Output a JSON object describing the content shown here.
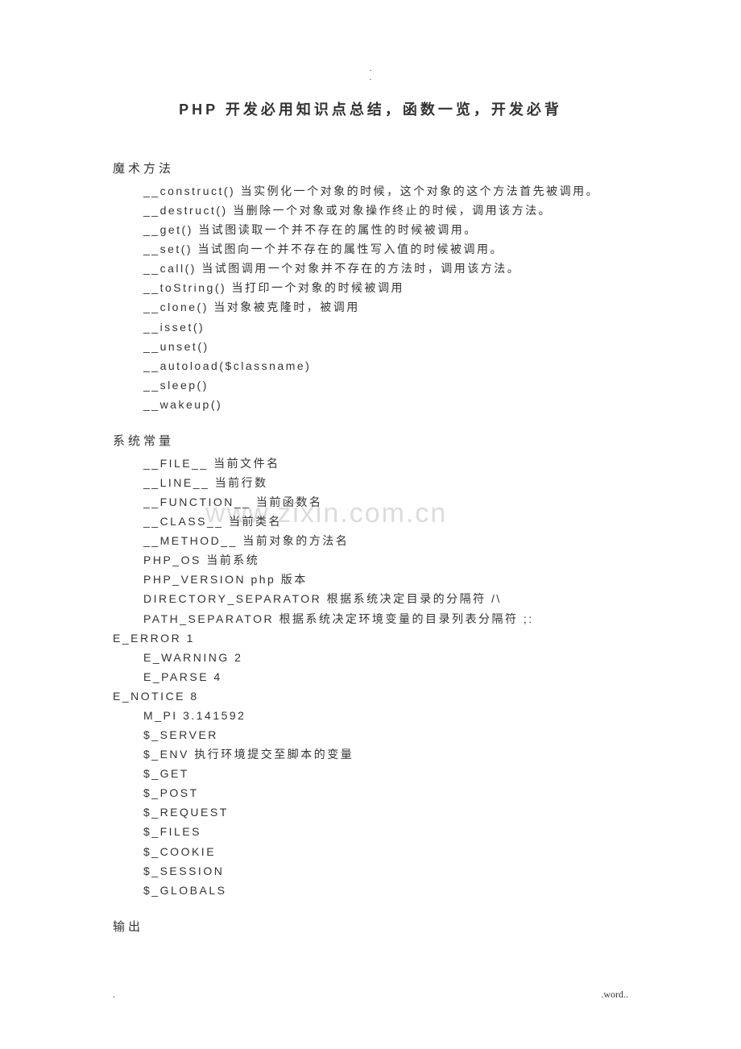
{
  "top_dot": ".",
  "title": "PHP 开发必用知识点总结，函数一览，开发必背",
  "section1": {
    "heading": "魔术方法",
    "lines": [
      "__construct() 当实例化一个对象的时候，这个对象的这个方法首先被调用。",
      "__destruct() 当删除一个对象或对象操作终止的时候，调用该方法。",
      "__get() 当试图读取一个并不存在的属性的时候被调用。",
      "__set() 当试图向一个并不存在的属性写入值的时候被调用。",
      "__call() 当试图调用一个对象并不存在的方法时，调用该方法。",
      "__toString() 当打印一个对象的时候被调用",
      "__clone() 当对象被克隆时，被调用",
      "__isset()",
      "__unset()",
      "__autoload($classname)",
      "__sleep()",
      "__wakeup()"
    ]
  },
  "section2": {
    "heading": "系统常量",
    "lines": [
      "__FILE__  当前文件名",
      "__LINE__  当前行数",
      "__FUNCTION__  当前函数名",
      "__CLASS__  当前类名",
      "__METHOD__  当前对象的方法名",
      "PHP_OS  当前系统",
      "PHP_VERSION php 版本",
      "DIRECTORY_SEPARATOR  根据系统决定目录的分隔符 /\\",
      "PATH_SEPARATOR  根据系统决定环境变量的目录列表分隔符 ;:"
    ],
    "line_eerror": "E_ERROR 1",
    "lines2": [
      "E_WARNING 2",
      "E_PARSE 4"
    ],
    "line_enotice": "E_NOTICE 8",
    "lines3": [
      "M_PI       3.141592",
      "$_SERVER",
      "$_ENV  执行环境提交至脚本的变量",
      "$_GET",
      "$_POST",
      "$_REQUEST",
      "$_FILES",
      "$_COOKIE",
      "$_SESSION",
      "$_GLOBALS"
    ]
  },
  "section3": {
    "heading": "输出"
  },
  "watermark": "www.zixin.com.cn",
  "footer_left": ".",
  "footer_right": ".word.."
}
